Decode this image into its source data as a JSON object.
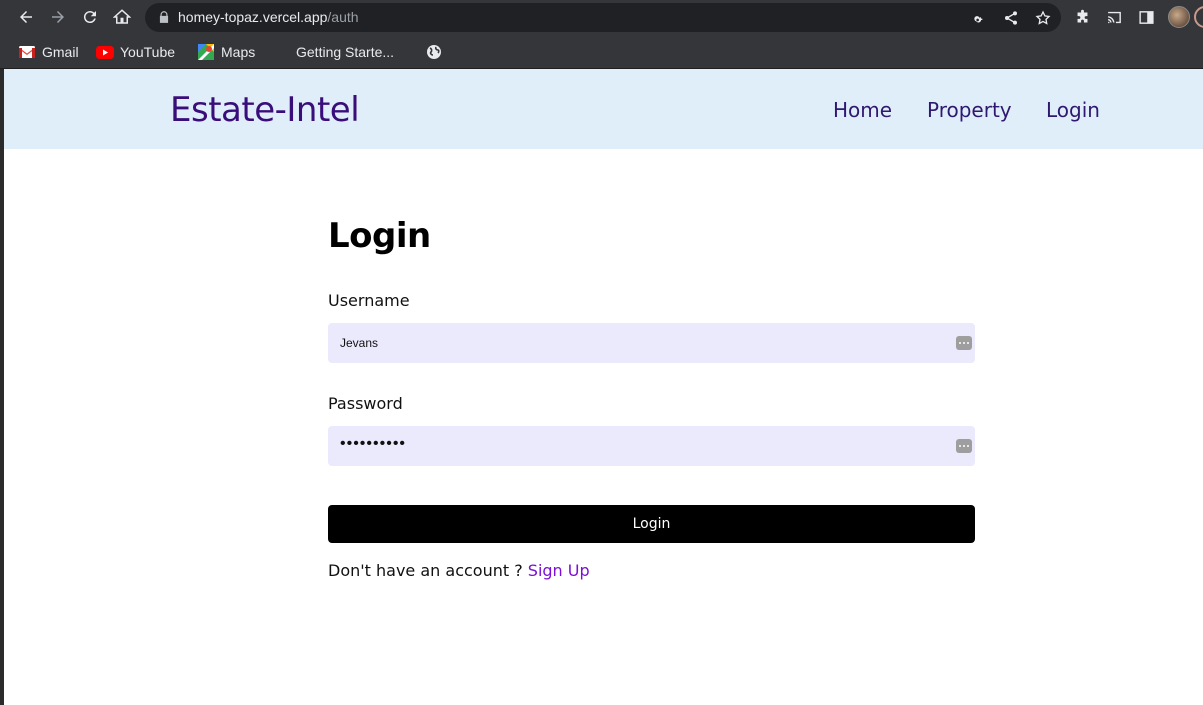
{
  "browser": {
    "url_host": "homey-topaz.vercel.app",
    "url_path": "/auth",
    "bookmarks": [
      {
        "label": "Gmail",
        "icon": "gmail-icon"
      },
      {
        "label": "YouTube",
        "icon": "youtube-icon"
      },
      {
        "label": "Maps",
        "icon": "maps-icon"
      },
      {
        "label": "Getting Starte...",
        "icon": "page-icon"
      },
      {
        "label": "",
        "icon": "globe-icon"
      }
    ]
  },
  "header": {
    "brand": "Estate-Intel",
    "nav": [
      {
        "label": "Home"
      },
      {
        "label": "Property"
      },
      {
        "label": "Login"
      }
    ]
  },
  "form": {
    "title": "Login",
    "username_label": "Username",
    "username_value": "Jevans",
    "password_label": "Password",
    "password_masked": "••••••••••",
    "submit_label": "Login",
    "signup_prompt": "Don't have an account ? ",
    "signup_link": "Sign Up"
  },
  "colors": {
    "header_bg": "#e0eef9",
    "brand": "#3a0e7a",
    "input_bg": "#ebe9fc",
    "button_bg": "#000000",
    "link": "#7b0fd6"
  }
}
